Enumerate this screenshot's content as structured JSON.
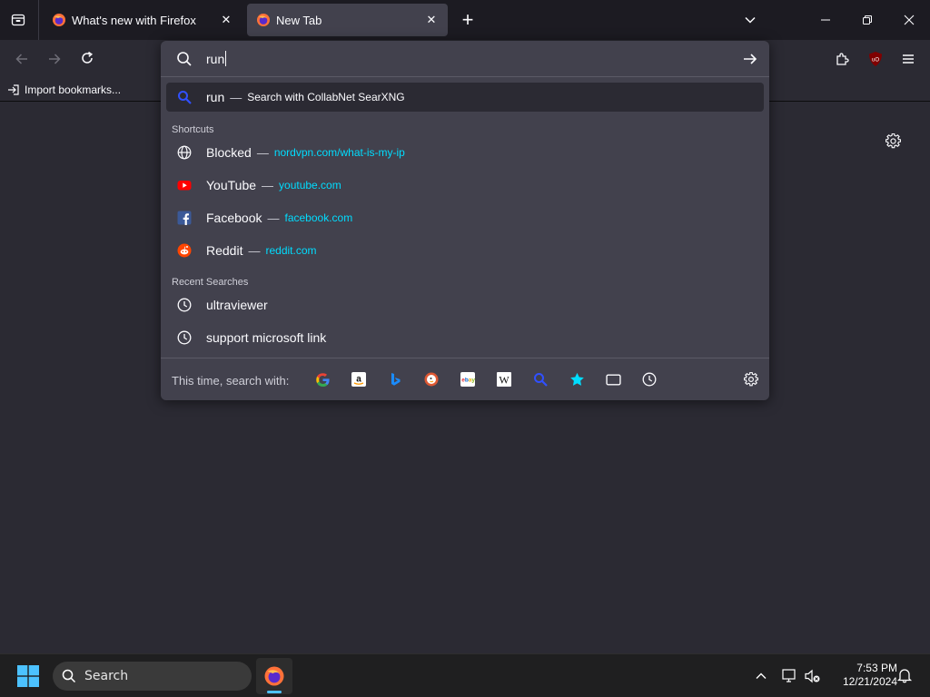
{
  "tabs": [
    {
      "label": "What's new with Firefox",
      "close": "✕",
      "active": false
    },
    {
      "label": "New Tab",
      "close": "✕",
      "active": true
    }
  ],
  "new_tab_symbol": "+",
  "bookmarks": {
    "import_label": "Import bookmarks..."
  },
  "urlbar": {
    "query": "run",
    "search_row": {
      "term": "run",
      "separator": "—",
      "action": "Search with CollabNet SearXNG"
    },
    "shortcuts_label": "Shortcuts",
    "shortcuts": [
      {
        "title": "Blocked",
        "separator": "—",
        "url": "nordvpn.com/what-is-my-ip",
        "icon": "globe-icon"
      },
      {
        "title": "YouTube",
        "separator": "—",
        "url": "youtube.com",
        "icon": "youtube-icon"
      },
      {
        "title": "Facebook",
        "separator": "—",
        "url": "facebook.com",
        "icon": "facebook-icon"
      },
      {
        "title": "Reddit",
        "separator": "—",
        "url": "reddit.com",
        "icon": "reddit-icon"
      }
    ],
    "recent_label": "Recent Searches",
    "recent": [
      {
        "text": "ultraviewer",
        "icon": "history-icon"
      },
      {
        "text": "support microsoft link",
        "icon": "history-icon"
      }
    ],
    "oneoff_label": "This time, search with:",
    "engines": [
      "google-icon",
      "amazon-icon",
      "bing-icon",
      "duckduckgo-icon",
      "ebay-icon",
      "wikipedia-icon",
      "searxng-icon",
      "bookmarks-icon",
      "tabs-icon",
      "history-icon"
    ]
  },
  "taskbar": {
    "search_label": "Search",
    "time": "7:53 PM",
    "date": "12/21/2024"
  },
  "colors": {
    "accent_url": "#00ddff",
    "panel_bg": "#42414d",
    "toolbar_bg": "#2b2a33",
    "tabstrip_bg": "#1c1b22"
  }
}
